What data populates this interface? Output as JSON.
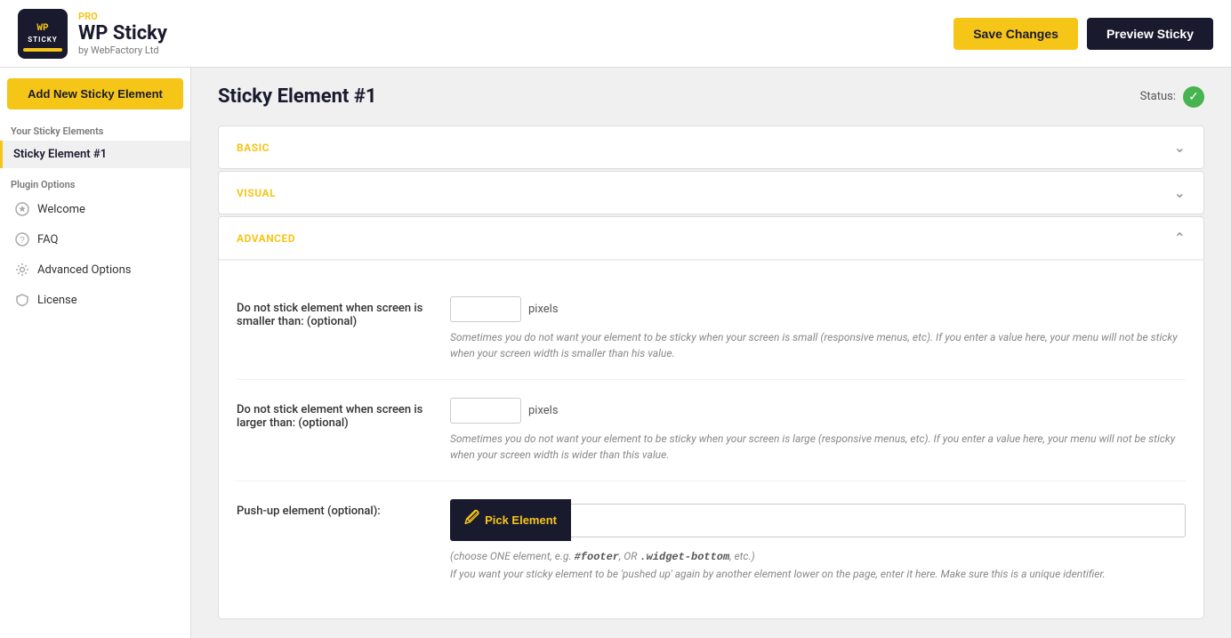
{
  "header": {
    "logo_title": "WP Sticky",
    "logo_pro_label": "PRO",
    "logo_by": "by WebFactory Ltd",
    "save_label": "Save Changes",
    "preview_label": "Preview Sticky"
  },
  "sidebar": {
    "add_new_label": "Add New Sticky Element",
    "sticky_elements_label": "Your Sticky Elements",
    "active_item": "Sticky Element #1",
    "plugin_options_label": "Plugin Options",
    "nav_items": [
      {
        "label": "Welcome",
        "icon": "star"
      },
      {
        "label": "FAQ",
        "icon": "help"
      },
      {
        "label": "Advanced Options",
        "icon": "settings"
      },
      {
        "label": "License",
        "icon": "shield"
      }
    ]
  },
  "main": {
    "page_title": "Sticky Element #1",
    "status_label": "Status:",
    "sections": [
      {
        "id": "basic",
        "title": "BASIC",
        "collapsed": true
      },
      {
        "id": "visual",
        "title": "VISUAL",
        "collapsed": true
      },
      {
        "id": "advanced",
        "title": "ADVANCED",
        "collapsed": false
      }
    ],
    "advanced": {
      "fields": [
        {
          "label": "Do not stick element when screen is smaller than: (optional)",
          "suffix": "pixels",
          "hint": "Sometimes you do not want your element to be sticky when your screen is small (responsive menus, etc). If you enter a value here, your menu will not be sticky when your screen width is smaller than his value."
        },
        {
          "label": "Do not stick element when screen is larger than: (optional)",
          "suffix": "pixels",
          "hint": "Sometimes you do not want your element to be sticky when your screen is large (responsive menus, etc). If you enter a value here, your menu will not be sticky when your screen width is wider than this value."
        }
      ],
      "push_up_label": "Push-up element (optional):",
      "pick_element_label": "Pick Element",
      "pick_hint_line1": "(choose ONE element, e.g. #footer, OR .widget-bottom, etc.)",
      "pick_hint_line2": "If you want your sticky element to be 'pushed up' again by another element lower on the page, enter it here. Make sure this is a unique identifier."
    }
  }
}
